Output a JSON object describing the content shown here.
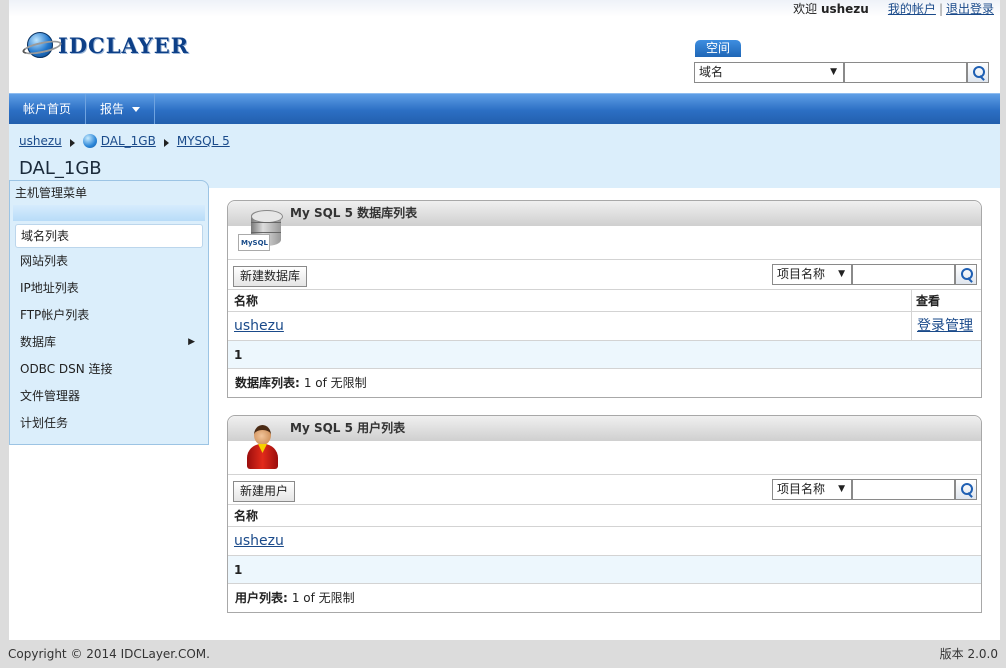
{
  "top": {
    "welcome": "欢迎",
    "username": "ushezu",
    "my_account": "我的帐户",
    "logout": "退出登录"
  },
  "logo": {
    "text": "IDCLAYER"
  },
  "search": {
    "tab_label": "空间",
    "select_value": "域名",
    "input_value": ""
  },
  "nav": {
    "items": [
      {
        "label": "帐户首页"
      },
      {
        "label": "报告"
      }
    ]
  },
  "breadcrumb": {
    "items": [
      "ushezu",
      "DAL_1GB",
      "MYSQL 5"
    ]
  },
  "page_title": "DAL_1GB",
  "sidebar": {
    "title": "主机管理菜单",
    "items": [
      {
        "label": "域名列表"
      },
      {
        "label": "网站列表"
      },
      {
        "label": "IP地址列表"
      },
      {
        "label": "FTP帐户列表"
      },
      {
        "label": "数据库"
      },
      {
        "label": "ODBC DSN 连接"
      },
      {
        "label": "文件管理器"
      },
      {
        "label": "计划任务"
      }
    ]
  },
  "db_panel": {
    "title": "My SQL 5 数据库列表",
    "icon_text": "MySQL",
    "new_button": "新建数据库",
    "filter_select": "项目名称",
    "filter_value": "",
    "columns": [
      "名称",
      "查看"
    ],
    "rows": [
      {
        "name": "ushezu",
        "action": "登录管理"
      }
    ],
    "page": "1",
    "footer_label": "数据库列表:",
    "footer_value": "1 of 无限制"
  },
  "user_panel": {
    "title": "My SQL 5 用户列表",
    "new_button": "新建用户",
    "filter_select": "项目名称",
    "filter_value": "",
    "columns": [
      "名称"
    ],
    "rows": [
      {
        "name": "ushezu"
      }
    ],
    "page": "1",
    "footer_label": "用户列表:",
    "footer_value": "1 of 无限制"
  },
  "footer": {
    "copyright": "Copyright © 2014 IDCLayer.COM.",
    "version": "版本 2.0.0"
  },
  "colors": {
    "nav_blue": "#2c6fc4",
    "light_blue": "#dbeefb",
    "link": "#1a4a8a"
  }
}
